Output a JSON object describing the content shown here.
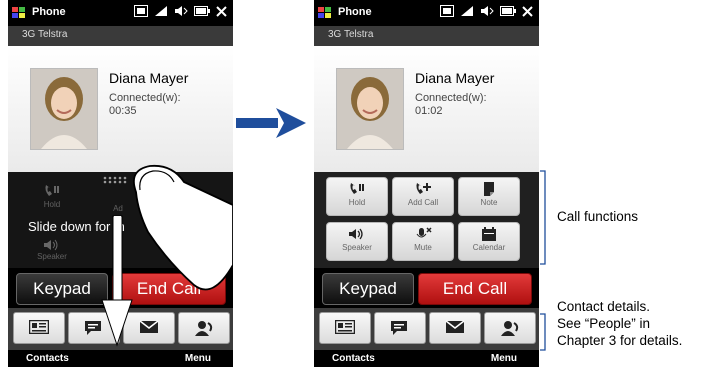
{
  "status": {
    "app_title": "Phone",
    "carrier": "3G Telstra"
  },
  "left_screen": {
    "contact_name": "Diana Mayer",
    "call_status": "Connected(w):",
    "timer": "00:35",
    "slide_hint": "Slide down for m"
  },
  "right_screen": {
    "contact_name": "Diana Mayer",
    "call_status": "Connected(w):",
    "timer": "01:02"
  },
  "functions": {
    "hold": "Hold",
    "add_call": "Add Call",
    "note": "Note",
    "speaker": "Speaker",
    "mute": "Mute",
    "calendar": "Calendar"
  },
  "left_partial_labels": {
    "add_call": "Ad"
  },
  "actions": {
    "keypad": "Keypad",
    "end_call": "End Call"
  },
  "softkeys": {
    "left": "Contacts",
    "right": "Menu"
  },
  "annotations": {
    "call_functions": "Call functions",
    "contact_details_1": "Contact details.",
    "contact_details_2": "See “People” in",
    "contact_details_3": "Chapter 3 for details."
  },
  "icons": [
    "windows-logo-icon",
    "network-icon",
    "signal-icon",
    "volume-icon",
    "battery-icon",
    "close-icon",
    "hold-icon",
    "add-call-icon",
    "note-icon",
    "speaker-icon",
    "mute-icon",
    "calendar-icon",
    "contact-card-icon",
    "message-icon",
    "email-icon",
    "people-icon",
    "arrow-right-icon",
    "arrow-down-icon",
    "finger-icon",
    "drag-handle-icon"
  ],
  "colors": {
    "end_call": "#cc2020",
    "arrow": "#1f4e9c",
    "brace": "#1f4e9c"
  }
}
